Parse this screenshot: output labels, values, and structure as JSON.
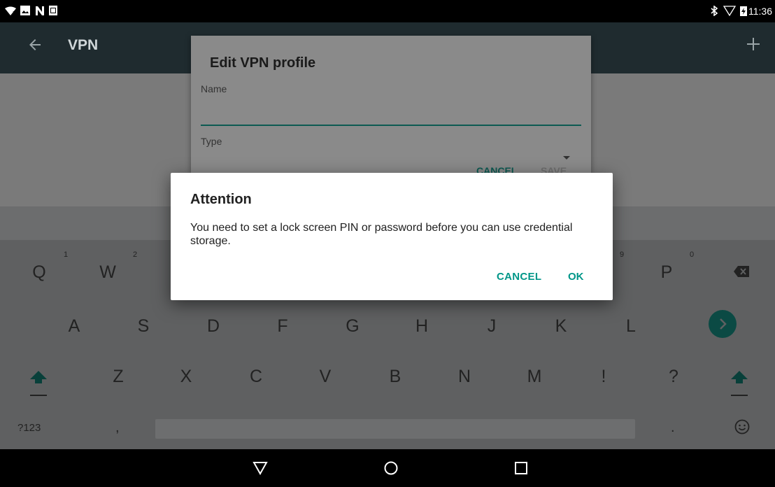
{
  "status_bar": {
    "time": "11:36",
    "left_icons": [
      "wifi-question-icon",
      "image-icon",
      "n-notification-icon",
      "sd-card-icon"
    ],
    "right_icons": [
      "bluetooth-icon",
      "signal-icon",
      "battery-charging-icon"
    ]
  },
  "app_bar": {
    "title": "VPN",
    "back_icon": "back-arrow-icon",
    "add_icon": "plus-icon"
  },
  "vpn_dialog": {
    "title": "Edit VPN profile",
    "name_label": "Name",
    "name_value": "",
    "type_label": "Type",
    "cancel_label": "CANCEL",
    "save_label": "SAVE"
  },
  "attention_dialog": {
    "title": "Attention",
    "message": "You need to set a lock screen PIN or password before you can use credential storage.",
    "cancel_label": "CANCEL",
    "ok_label": "OK"
  },
  "keyboard": {
    "row1": [
      "Q",
      "W",
      "P"
    ],
    "row1_hints": [
      "1",
      "2",
      "9",
      "0"
    ],
    "row2": [
      "A",
      "S",
      "D",
      "F",
      "G",
      "H",
      "J",
      "K",
      "L"
    ],
    "row3": [
      "Z",
      "X",
      "C",
      "V",
      "B",
      "N",
      "M",
      "!",
      "?"
    ],
    "row4": [
      "?123",
      ",",
      "."
    ],
    "icons": [
      "backspace-icon",
      "enter-icon",
      "shift-icon",
      "emoji-icon"
    ]
  },
  "nav_bar": {
    "icons": [
      "nav-back-icon",
      "nav-home-icon",
      "nav-recents-icon"
    ]
  },
  "colors": {
    "accent": "#009688",
    "app_bar": "#1f2b2f",
    "dialog_bg": "#ffffff"
  }
}
